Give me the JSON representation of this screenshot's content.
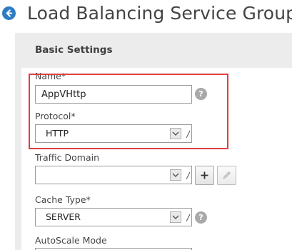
{
  "header": {
    "title": "Load Balancing Service Group",
    "back_icon": "back-arrow-icon"
  },
  "section": {
    "title": "Basic Settings"
  },
  "form": {
    "name": {
      "label": "Name*",
      "value": "AppVHttp"
    },
    "protocol": {
      "label": "Protocol*",
      "value": "HTTP"
    },
    "traffic_domain": {
      "label": "Traffic Domain",
      "value": ""
    },
    "cache_type": {
      "label": "Cache Type*",
      "value": "SERVER"
    },
    "autoscale_mode": {
      "label": "AutoScale Mode"
    }
  },
  "help_glyph": "?",
  "colors": {
    "accent": "#2f7bc4",
    "highlight_border": "#e04040",
    "panel_bg": "#ececec"
  }
}
